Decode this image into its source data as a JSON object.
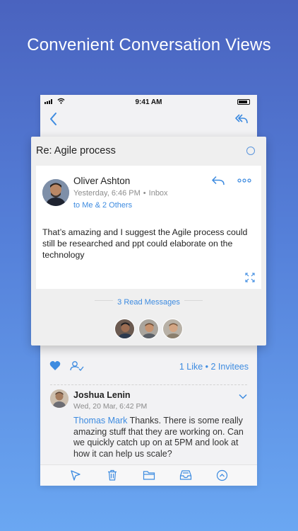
{
  "headline": "Convenient Conversation Views",
  "status_bar": {
    "time": "9:41 AM"
  },
  "card": {
    "subject": "Re: Agile process",
    "message": {
      "sender": "Oliver Ashton",
      "timestamp": "Yesterday, 6:46 PM",
      "folder": "Inbox",
      "recipients": "to Me & 2 Others",
      "body": "That’s amazing and I suggest the Agile process could still be researched and ppt could elaborate on the technology"
    },
    "read_messages": "3 Read Messages"
  },
  "actions": {
    "likes_invitees": "1 Like • 2 Invitees"
  },
  "message2": {
    "sender": "Joshua Lenin",
    "timestamp": "Wed, 20 Mar, 6:42 PM",
    "mention": "Thomas Mark",
    "body": " Thanks. There is some really amazing stuff that they are working on. Can we quickly catch up on at 5PM and look at how it can help us scale?"
  },
  "colors": {
    "accent": "#3d8be0",
    "background_top": "#4a63bf",
    "background_bottom": "#6aa7f2"
  },
  "icons": [
    "back-icon",
    "reply-all-icon",
    "reply-icon",
    "more-icon",
    "expand-icon",
    "heart-icon",
    "add-person-icon",
    "chevron-down-icon",
    "flag-icon",
    "trash-icon",
    "folder-icon",
    "archive-icon",
    "chevron-up-circle-icon"
  ]
}
